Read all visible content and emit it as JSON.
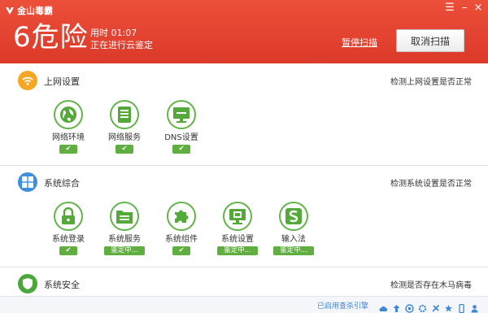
{
  "app": {
    "brand": "金山毒霸"
  },
  "window": {
    "menu_glyph": "☰",
    "minimize_glyph": "–",
    "close_glyph": "×"
  },
  "header": {
    "risk_count": "6",
    "risk_label": "危险",
    "elapsed_label": "用时",
    "elapsed_value": "01:07",
    "status": "正在进行云鉴定",
    "pause_label": "暂停扫描",
    "cancel_label": "取消扫描"
  },
  "sections": [
    {
      "title": "上网设置",
      "status": "检测上网设置是否正常",
      "icon": "wifi-icon",
      "color": "#f5a623",
      "items": [
        {
          "label": "网络环境",
          "icon": "globe-icon",
          "badge": "✔"
        },
        {
          "label": "网络服务",
          "icon": "server-icon",
          "badge": "✔"
        },
        {
          "label": "DNS设置",
          "icon": "monitor-icon",
          "badge": "✔"
        }
      ]
    },
    {
      "title": "系统综合",
      "status": "检测系统设置是否正常",
      "icon": "windows-icon",
      "color": "#3d8fe0",
      "items": [
        {
          "label": "系统登录",
          "icon": "lock-icon",
          "badge": "✔"
        },
        {
          "label": "系统服务",
          "icon": "folder-icon",
          "badge": "鉴定中..."
        },
        {
          "label": "系统组件",
          "icon": "puzzle-icon",
          "badge": "✔"
        },
        {
          "label": "系统设置",
          "icon": "monitor-settings-icon",
          "badge": "鉴定中..."
        },
        {
          "label": "输入法",
          "icon": "input-method-icon",
          "badge": "鉴定中..."
        }
      ]
    },
    {
      "title": "系统安全",
      "status": "检测是否存在木马病毒",
      "icon": "shield-icon",
      "color": "#4aa83a"
    }
  ],
  "footer": {
    "text": "已启用查杀引擎"
  },
  "colors": {
    "header": "#e2412f",
    "green": "#5fae3f",
    "link": "#3b87d8"
  }
}
